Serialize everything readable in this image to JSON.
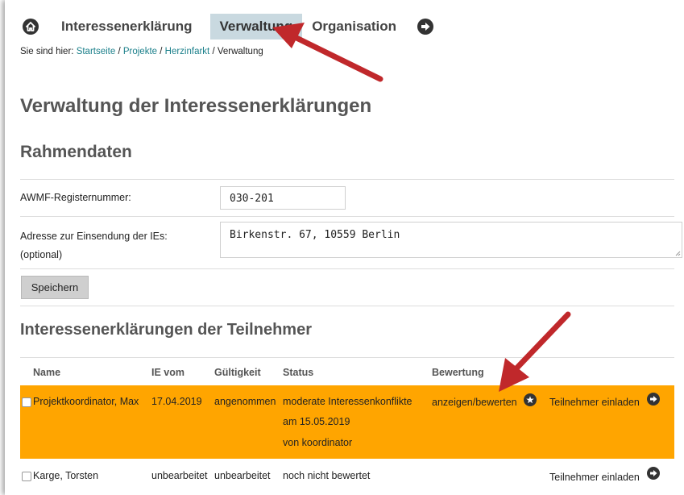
{
  "nav": {
    "home_icon": "home-icon",
    "tabs": [
      {
        "label": "Interessenerklärung"
      },
      {
        "label": "Verwaltung"
      },
      {
        "label": "Organisation"
      }
    ],
    "logout_icon": "logout-icon"
  },
  "breadcrumb": {
    "prefix": "Sie sind hier:",
    "items": [
      "Startseite",
      "Projekte",
      "Herzinfarkt"
    ],
    "current": "Verwaltung",
    "sep": " / "
  },
  "page_title": "Verwaltung der Interessenerklärungen",
  "rahmendaten": {
    "heading": "Rahmendaten",
    "awmf_label": "AWMF-Registernummer:",
    "awmf_value": "030-201",
    "address_label": "Adresse zur Einsendung der IEs:",
    "address_optional": "(optional)",
    "address_value": "Birkenstr. 67, 10559 Berlin",
    "save_label": "Speichern"
  },
  "participants": {
    "heading": "Interessenerklärungen der Teilnehmer",
    "columns": [
      "Name",
      "IE vom",
      "Gültigkeit",
      "Status",
      "Bewertung"
    ],
    "rows": [
      {
        "name": "Projektkoordinator, Max",
        "ie_vom": "17.04.2019",
        "gueltigkeit": "angenommen",
        "status": [
          "moderate Interessenkonflikte",
          "am 15.05.2019",
          "von koordinator"
        ],
        "bewertung": "anzeigen/bewerten",
        "invite": "Teilnehmer einladen",
        "highlight_color": "#ffa500"
      },
      {
        "name": "Karge, Torsten",
        "ie_vom": "unbearbeitet",
        "gueltigkeit": "unbearbeitet",
        "status": [
          "noch nicht bewertet"
        ],
        "bewertung": "",
        "invite": "Teilnehmer einladen"
      }
    ]
  },
  "colors": {
    "accent_link": "#1a7f8a",
    "active_tab": "#c9d9e0",
    "highlight": "#ffa500",
    "arrow": "#c0282b"
  }
}
